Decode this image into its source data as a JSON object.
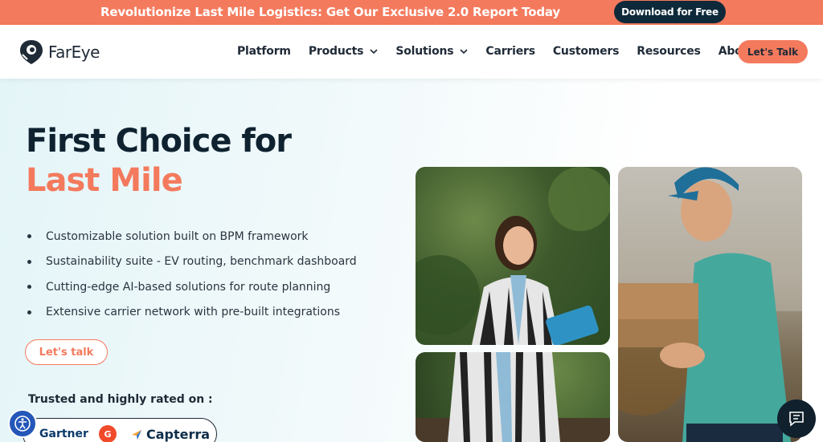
{
  "announcement": {
    "text": "Revolutionize Last Mile Logistics: Get Our Exclusive 2.0 Report Today",
    "button_label": "Download for Free"
  },
  "header": {
    "logo_text": "FarEye",
    "nav": [
      {
        "label": "Platform",
        "has_dropdown": false
      },
      {
        "label": "Products",
        "has_dropdown": true
      },
      {
        "label": "Solutions",
        "has_dropdown": true
      },
      {
        "label": "Carriers",
        "has_dropdown": false
      },
      {
        "label": "Customers",
        "has_dropdown": false
      },
      {
        "label": "Resources",
        "has_dropdown": false
      },
      {
        "label": "About",
        "has_dropdown": true
      }
    ],
    "cta_label": "Let's Talk"
  },
  "hero": {
    "title_line1": "First Choice for",
    "title_line2": "Last Mile",
    "bullets": [
      "Customizable solution built on BPM framework",
      "Sustainability suite - EV routing, benchmark dashboard",
      "Cutting-edge AI-based solutions for route planning",
      "Extensive carrier network with pre-built integrations"
    ],
    "cta_label": "Let's talk",
    "trusted_label": "Trusted and highly rated on :",
    "ratings": {
      "gartner": "Gartner",
      "g2": "G",
      "capterra": "Capterra"
    }
  },
  "colors": {
    "accent": "#f47a5d",
    "dark": "#0e2a3a",
    "text": "#1f2a37"
  },
  "icons": {
    "accessibility": "accessibility-icon",
    "chat": "chat-icon",
    "chevron": "chevron-down-icon"
  }
}
